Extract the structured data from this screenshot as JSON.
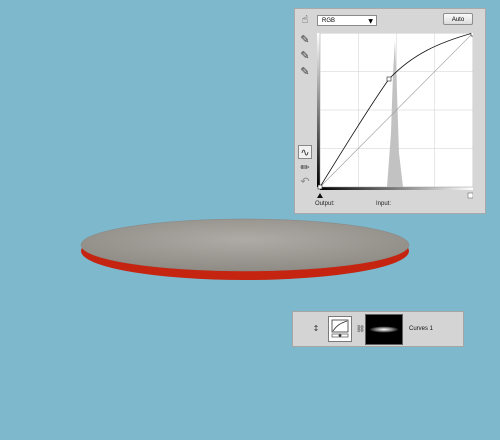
{
  "colors": {
    "canvas_background": "#7db8cd",
    "plate_top": "#a19e98",
    "plate_rim": "#c52510",
    "panel_background": "#d6d6d6"
  },
  "curves_panel": {
    "channel": "RGB",
    "auto_label": "Auto",
    "output_label": "Output:",
    "input_label": "Input:",
    "tools": [
      "hand-adjust-icon",
      "black-eyedropper-icon",
      "gray-eyedropper-icon",
      "white-eyedropper-icon",
      "curve-point-icon",
      "pencil-icon",
      "smooth-icon"
    ],
    "curve_points": [
      [
        0,
        0
      ],
      [
        0.45,
        0.71
      ],
      [
        1,
        1
      ]
    ]
  },
  "layers_panel": {
    "layer_name": "Curves 1",
    "visibility_icon": "eye-icon",
    "link_icon": "chain-link-icon"
  }
}
